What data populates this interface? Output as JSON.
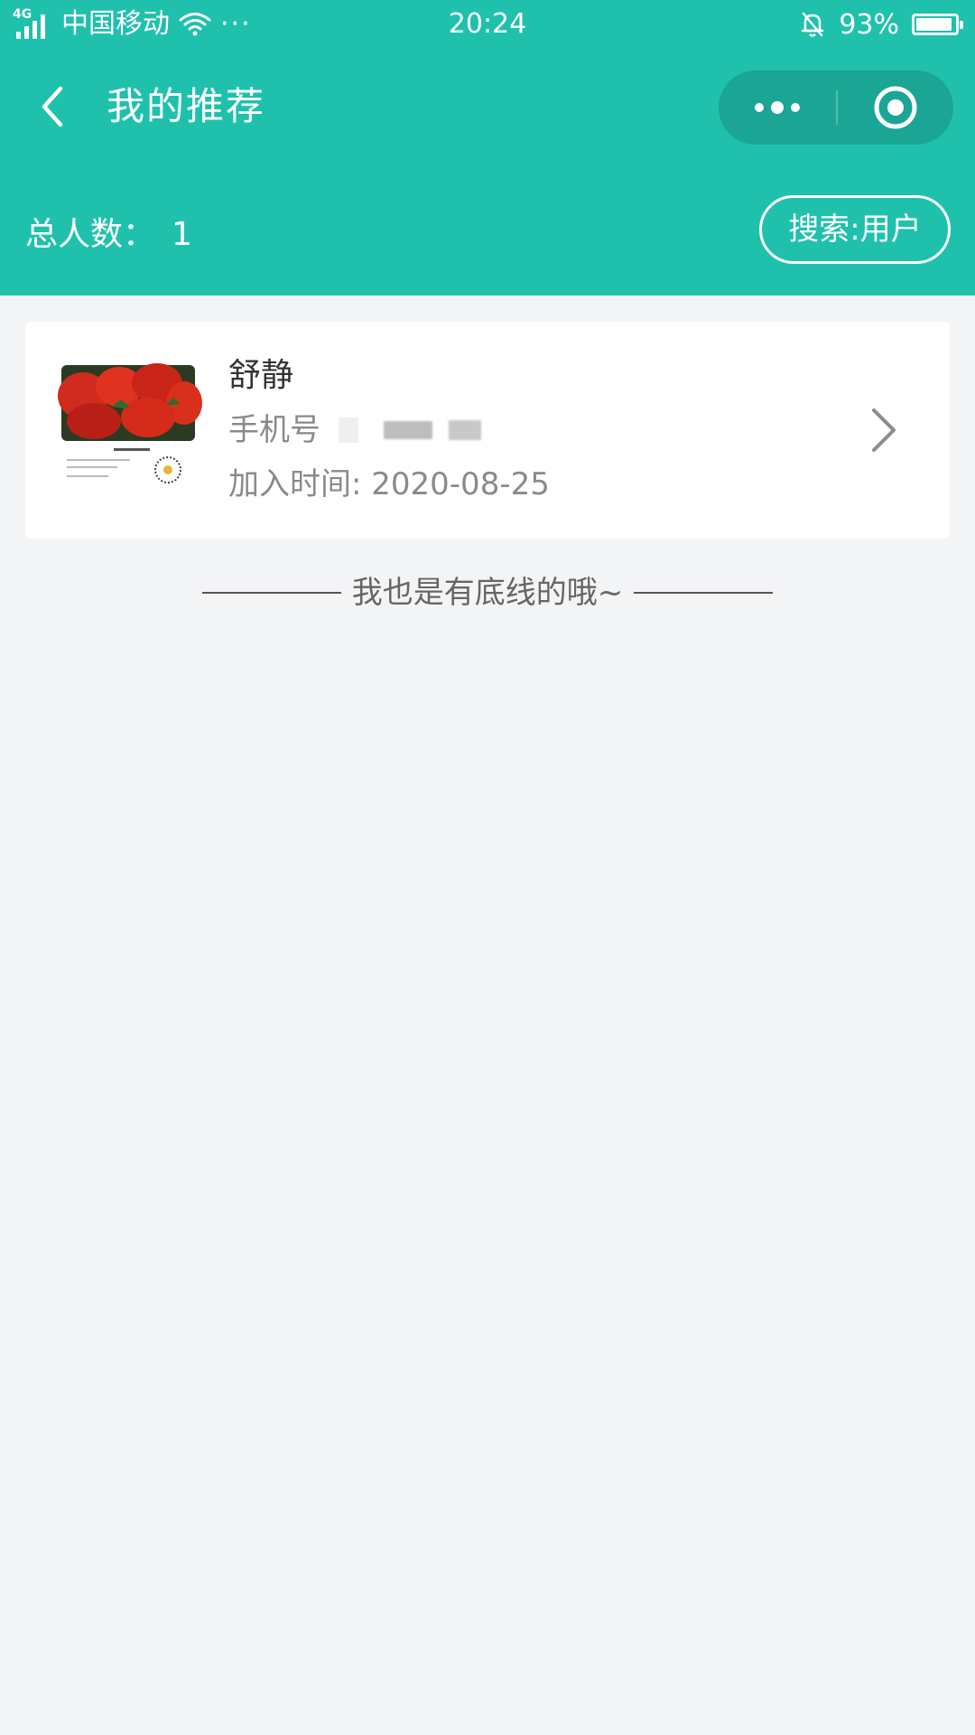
{
  "status_bar": {
    "network": "4G",
    "carrier": "中国移动",
    "overflow": "···",
    "time": "20:24",
    "battery_percent": "93%",
    "battery_level": 0.93,
    "icons": [
      "signal-icon",
      "wifi-icon",
      "bell-off-icon",
      "battery-icon"
    ]
  },
  "navbar": {
    "title": "我的推荐",
    "back_icon": "chevron-left-icon",
    "capsule": {
      "more_icon": "more-dots-icon",
      "close_icon": "target-icon"
    }
  },
  "summary": {
    "total_label": "总人数：",
    "total_value": "1",
    "search_label": "搜索:用户"
  },
  "members": [
    {
      "name": "舒静",
      "phone_label": "手机号",
      "join_label": "加入时间: 2020-08-25",
      "avatar_icon": "tomato-photo"
    }
  ],
  "footer_text": "我也是有底线的哦~",
  "colors": {
    "accent": "#1fc1ad",
    "background": "#f3f4f6",
    "card": "#ffffff",
    "muted_text": "#8a8a8a"
  }
}
